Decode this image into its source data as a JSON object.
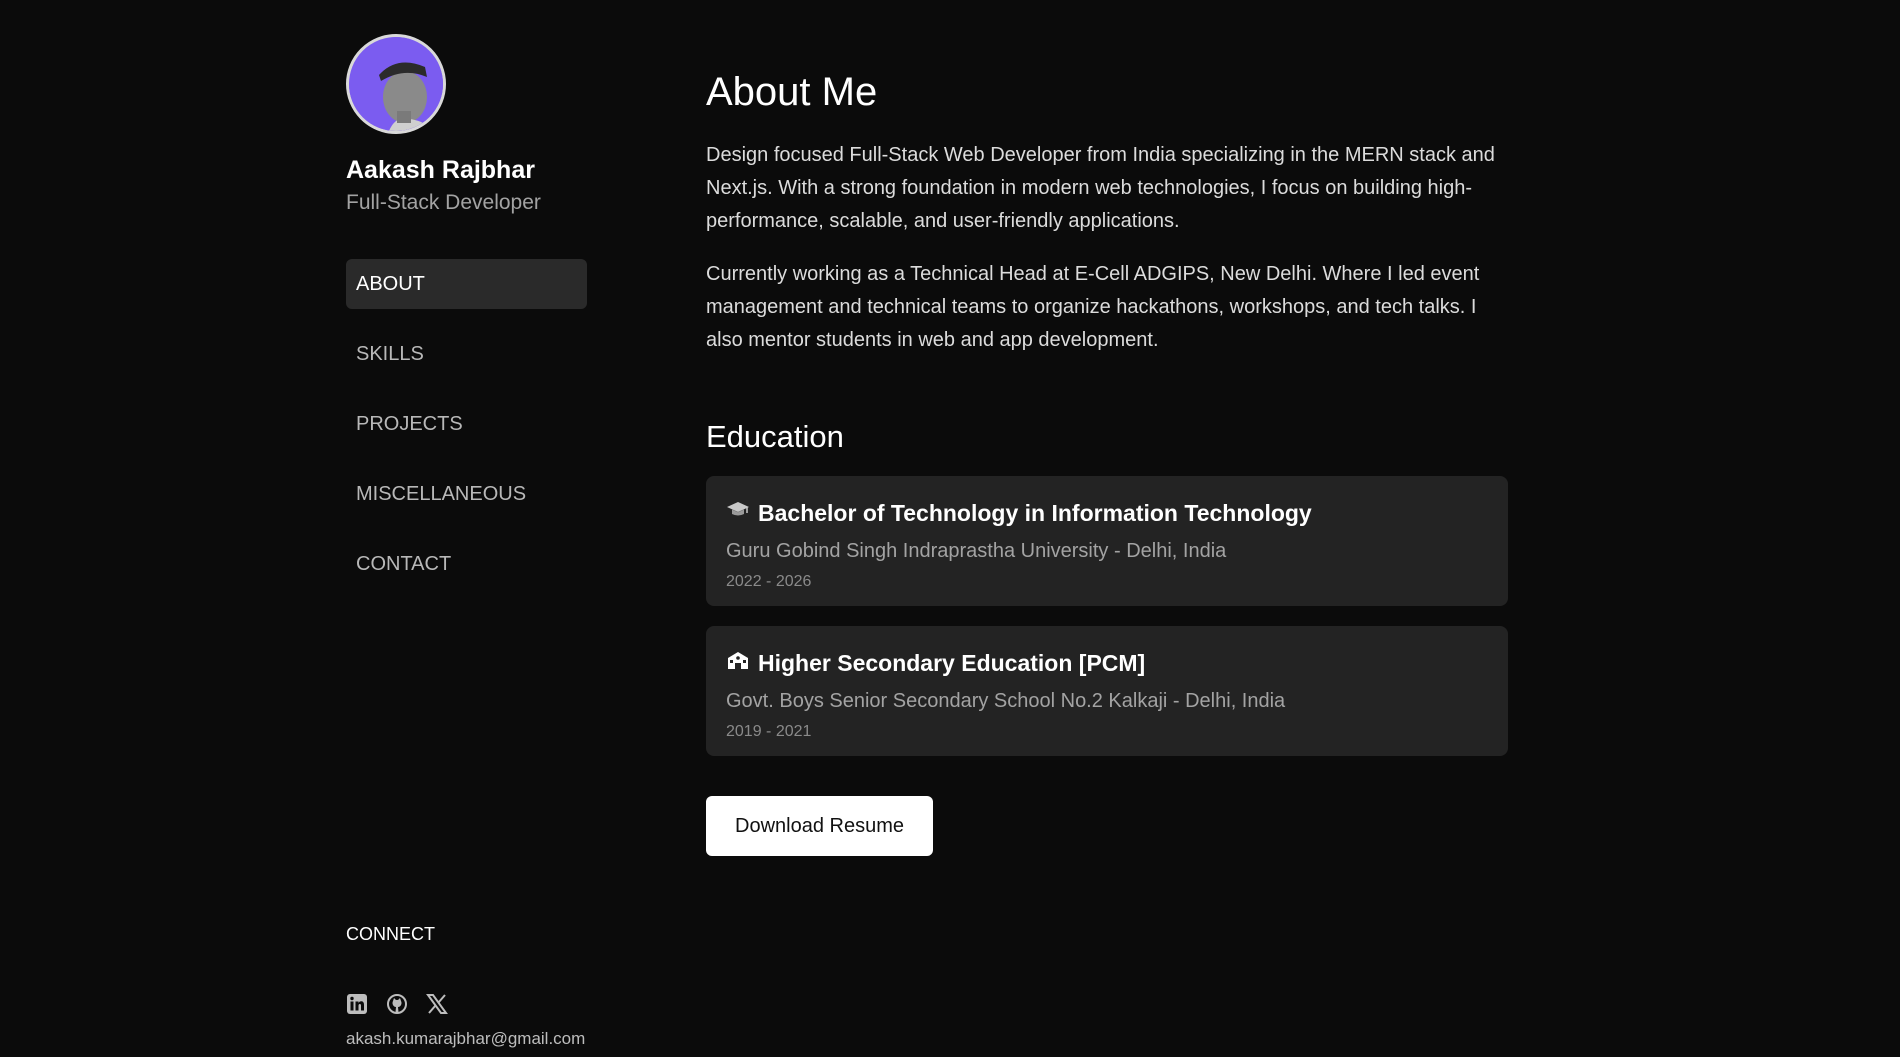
{
  "profile": {
    "name": "Aakash Rajbhar",
    "role": "Full-Stack Developer",
    "avatar_bg": "#7b5cf0"
  },
  "nav": {
    "items": [
      {
        "label": "ABOUT",
        "active": true
      },
      {
        "label": "SKILLS",
        "active": false
      },
      {
        "label": "PROJECTS",
        "active": false
      },
      {
        "label": "MISCELLANEOUS",
        "active": false
      },
      {
        "label": "CONTACT",
        "active": false
      }
    ]
  },
  "connect": {
    "heading": "CONNECT",
    "icons": [
      "linkedin-icon",
      "github-icon",
      "x-icon"
    ],
    "email": "akash.kumarajbhar@gmail.com"
  },
  "about": {
    "title": "About Me",
    "paragraphs": [
      "Design focused Full-Stack Web Developer from India specializing in the MERN stack and Next.js. With a strong foundation in modern web technologies, I focus on building high-performance, scalable, and user-friendly applications.",
      "Currently working as a Technical Head at E-Cell ADGIPS, New Delhi. Where I led event management and technical teams to organize hackathons, workshops, and tech talks. I also mentor students in web and app development."
    ]
  },
  "education": {
    "title": "Education",
    "items": [
      {
        "icon": "graduation-cap-icon",
        "degree": "Bachelor of Technology in Information Technology",
        "school": "Guru Gobind Singh Indraprastha University - Delhi, India",
        "years": "2022 - 2026"
      },
      {
        "icon": "school-icon",
        "degree": "Higher Secondary Education [PCM]",
        "school": "Govt. Boys Senior Secondary School No.2 Kalkaji - Delhi, India",
        "years": "2019 - 2021"
      }
    ]
  },
  "actions": {
    "download_label": "Download Resume"
  },
  "colors": {
    "background": "#0b0b0b",
    "card": "#232323",
    "nav_active": "#2a2a2a",
    "accent": "#7b5cf0"
  }
}
